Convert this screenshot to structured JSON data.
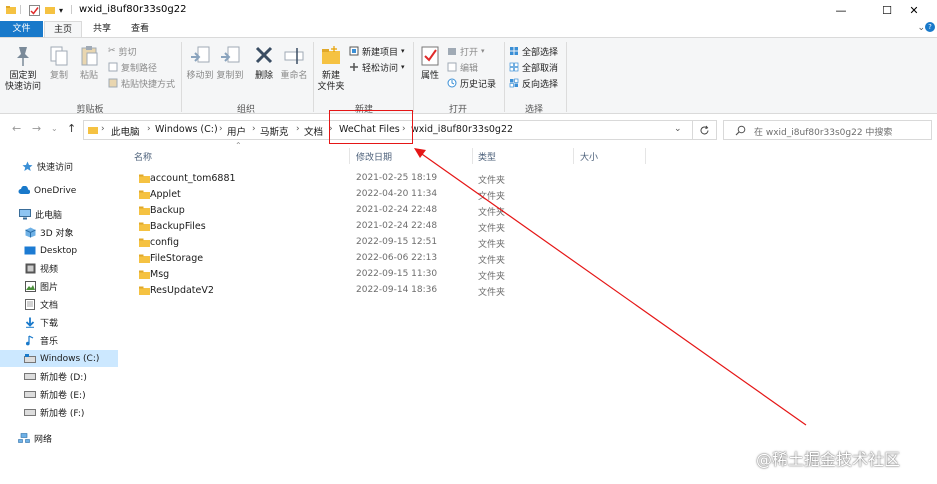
{
  "window": {
    "title": "wxid_i8uf80r33s0g22",
    "minimize": "—",
    "maximize": "☐",
    "close": "✕"
  },
  "tabs": [
    {
      "label": "文件"
    },
    {
      "label": "主页"
    },
    {
      "label": "共享"
    },
    {
      "label": "查看"
    }
  ],
  "ribbon": {
    "clipboard": {
      "pin": "固定到\n快速访问",
      "copy": "复制",
      "paste": "粘贴",
      "cut": "剪切",
      "copy_path": "复制路径",
      "paste_shortcut": "粘贴快捷方式",
      "group": "剪贴板"
    },
    "organize": {
      "move_to": "移动到",
      "copy_to": "复制到",
      "delete": "删除",
      "rename": "重命名",
      "group": "组织"
    },
    "new": {
      "new_folder": "新建\n文件夹",
      "new_item": "新建项目",
      "easy_access": "轻松访问",
      "group": "新建"
    },
    "open": {
      "properties": "属性",
      "open": "打开",
      "edit": "编辑",
      "history": "历史记录",
      "group": "打开"
    },
    "select": {
      "select_all": "全部选择",
      "select_none": "全部取消",
      "invert": "反向选择",
      "group": "选择"
    }
  },
  "address": {
    "crumbs": [
      "此电脑",
      "Windows (C:)",
      "用户",
      "马斯克",
      "文档",
      "WeChat Files",
      "wxid_i8uf80r33s0g22"
    ],
    "search_placeholder": "在 wxid_i8uf80r33s0g22 中搜索"
  },
  "sidebar": {
    "items": [
      {
        "label": "快速访问",
        "icon": "star-icon"
      },
      {
        "label": "OneDrive",
        "icon": "cloud-icon"
      },
      {
        "label": "此电脑",
        "icon": "computer-icon"
      },
      {
        "label": "3D 对象",
        "icon": "cube-icon"
      },
      {
        "label": "Desktop",
        "icon": "desktop-icon"
      },
      {
        "label": "视频",
        "icon": "video-icon"
      },
      {
        "label": "图片",
        "icon": "picture-icon"
      },
      {
        "label": "文档",
        "icon": "document-icon"
      },
      {
        "label": "下载",
        "icon": "download-icon"
      },
      {
        "label": "音乐",
        "icon": "music-icon"
      },
      {
        "label": "Windows (C:)",
        "icon": "drive-icon"
      },
      {
        "label": "新加卷 (D:)",
        "icon": "drive-icon"
      },
      {
        "label": "新加卷 (E:)",
        "icon": "drive-icon"
      },
      {
        "label": "新加卷 (F:)",
        "icon": "drive-icon"
      },
      {
        "label": "网络",
        "icon": "network-icon"
      }
    ]
  },
  "columns": {
    "name": "名称",
    "modified": "修改日期",
    "type": "类型",
    "size": "大小"
  },
  "files": [
    {
      "name": "account_tom6881",
      "date": "2021-02-25 18:19",
      "type": "文件夹"
    },
    {
      "name": "Applet",
      "date": "2022-04-20 11:34",
      "type": "文件夹"
    },
    {
      "name": "Backup",
      "date": "2021-02-24 22:48",
      "type": "文件夹"
    },
    {
      "name": "BackupFiles",
      "date": "2021-02-24 22:48",
      "type": "文件夹"
    },
    {
      "name": "config",
      "date": "2022-09-15 12:51",
      "type": "文件夹"
    },
    {
      "name": "FileStorage",
      "date": "2022-06-06 22:13",
      "type": "文件夹"
    },
    {
      "name": "Msg",
      "date": "2022-09-15 11:30",
      "type": "文件夹"
    },
    {
      "name": "ResUpdateV2",
      "date": "2022-09-14 18:36",
      "type": "文件夹"
    }
  ],
  "watermark": "@稀土掘金技术社区",
  "colors": {
    "accent": "#1979ca",
    "selection": "#cce8ff",
    "folder": "#f5c242",
    "annotation": "#e51616"
  }
}
